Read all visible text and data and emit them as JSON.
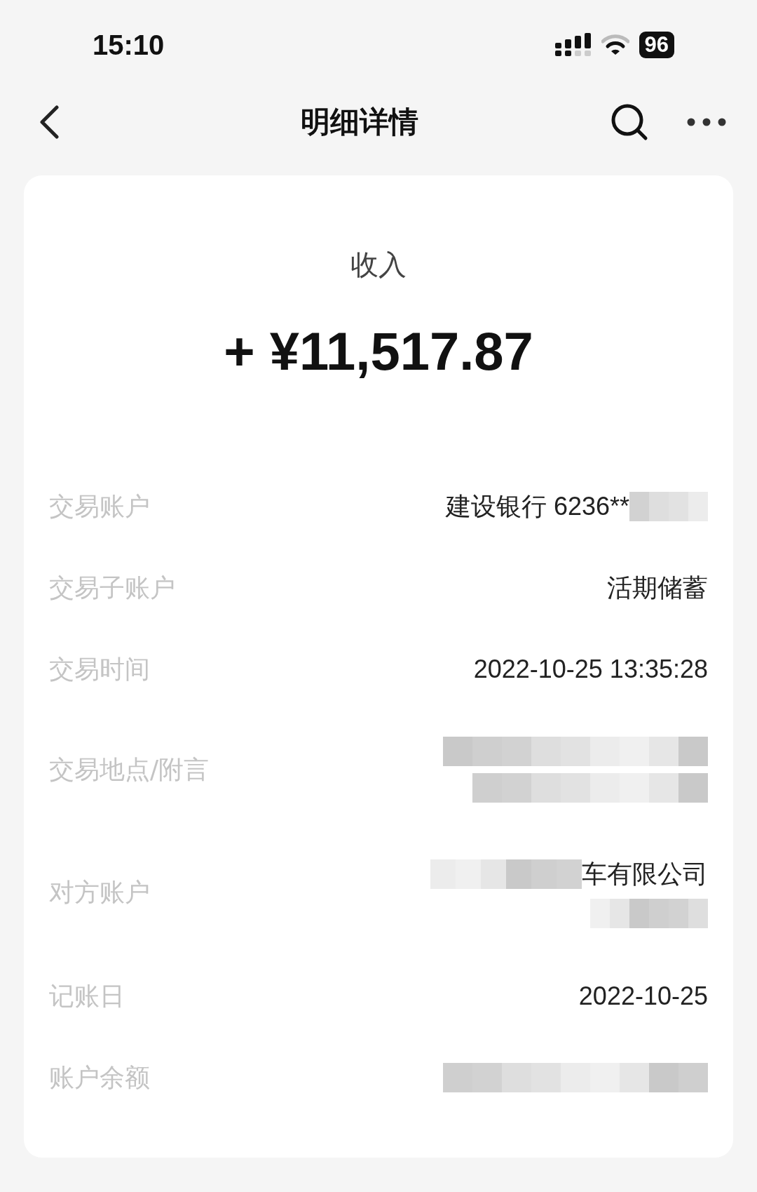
{
  "status_bar": {
    "time": "15:10",
    "battery": "96"
  },
  "nav": {
    "title": "明细详情"
  },
  "summary": {
    "type": "收入",
    "amount": "+ ¥11,517.87"
  },
  "rows": [
    {
      "label": "交易账户",
      "kind": "masked_tail",
      "lines": [
        "建设银行 6236**"
      ]
    },
    {
      "label": "交易子账户",
      "kind": "plain",
      "lines": [
        "活期储蓄"
      ]
    },
    {
      "label": "交易时间",
      "kind": "plain",
      "lines": [
        "2022-10-25 13:35:28"
      ]
    },
    {
      "label": "交易地点/附言",
      "kind": "masked",
      "lines": []
    },
    {
      "label": "对方账户",
      "kind": "masked_lead",
      "lines": [
        "车有限公司"
      ]
    },
    {
      "label": "记账日",
      "kind": "plain",
      "lines": [
        "2022-10-25"
      ]
    },
    {
      "label": "账户余额",
      "kind": "masked",
      "lines": []
    }
  ]
}
